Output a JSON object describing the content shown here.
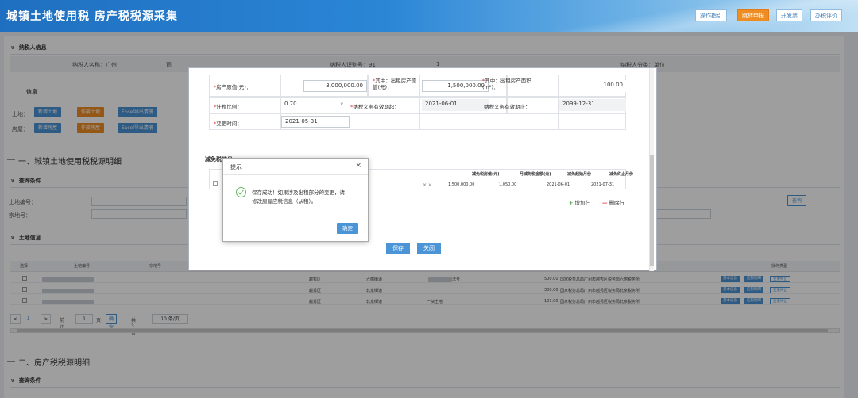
{
  "header": {
    "title": "城镇土地使用税 房产税税源采集",
    "buttons": [
      {
        "label": "操作指引",
        "active": false
      },
      {
        "label": "跳转申报",
        "active": true
      },
      {
        "label": "开发票",
        "active": false
      },
      {
        "label": "办税评价",
        "active": false
      }
    ]
  },
  "taxpayer": {
    "section_label": "纳税人信息",
    "name_label": "纳税人名称：广州",
    "name_suffix": "司",
    "id_label": "纳税人识别号：91",
    "id_suffix": "1",
    "type_label": "纳税人分类：单位"
  },
  "info_block": {
    "title": "信息",
    "land_label": "土地：",
    "land_buttons": [
      "新增土地",
      "作废土地",
      "Excel导出清册"
    ],
    "house_label": "房屋：",
    "house_buttons": [
      "新增房屋",
      "作废房屋",
      "Excel导出清册"
    ]
  },
  "section1": {
    "title": "一、城镇土地使用税税源明细",
    "query_label": "查询条件",
    "land_no_label": "土地编号：",
    "right_label": "宗地号：",
    "query_button": "查询",
    "land_info_label": "土地信息",
    "columns": [
      "选择",
      "土地编号",
      "宗地号",
      "操作类型"
    ],
    "rows": [
      {
        "district": "越秀区",
        "street": "六榕街道",
        "addr": "法号",
        "amount": "500.00",
        "org": "国家税务总局广州市越秀区税务局六榕税务所"
      },
      {
        "district": "越秀区",
        "street": "北京街道",
        "addr": "",
        "amount": "300.00",
        "org": "国家税务总局广州市越秀区税务局北京税务所"
      },
      {
        "district": "越秀区",
        "street": "北京街道",
        "addr": "一块土地",
        "amount": "131.00",
        "org": "国家税务总局广州市越秀区税务局北京税务所"
      }
    ],
    "row_actions": [
      "基本信息",
      "应税明细",
      "变更终止"
    ],
    "pager": {
      "page": "1",
      "goto_label": "前往",
      "goto_value": "1",
      "page_unit": "页",
      "confirm": "确定",
      "total": "共3条",
      "per_page": "10 条/页"
    }
  },
  "section2": {
    "title": "二、房产税税源明细",
    "query_label": "查询条件"
  },
  "edit_modal": {
    "fields": {
      "original_value_label": "房产原值(元)：",
      "original_value": "3,000,000.00",
      "rent_value_label": "其中：出租房产原值(元)：",
      "rent_value": "1,500,000.00",
      "rent_area_label": "其中：出租房产面积(m²)：",
      "rent_area": "100.00",
      "ratio_label": "计税比例：",
      "ratio_value": "0.70",
      "start_label": "纳税义务有效期起：",
      "start_value": "2021-06-01",
      "end_label": "纳税义务有效期止：",
      "end_value": "2099-12-31",
      "change_label": "变更时间：",
      "change_value": "2021-05-31"
    },
    "relief_title": "减免税信息",
    "relief_columns": [
      "减免税房值(元)",
      "月减免税金额(元)",
      "减免起始月份",
      "减免终止月份"
    ],
    "relief_row": [
      "1,500,000.00",
      "1,050.00",
      "2021-06-01",
      "2021-07-31"
    ],
    "add_row": "增加行",
    "delete_row": "删除行",
    "save": "保存",
    "close": "关闭"
  },
  "dialog": {
    "title": "提示",
    "message": "保存成功！如果涉及出租部分的变更，请修改房屋应税信息（从租）。",
    "ok": "确定"
  }
}
